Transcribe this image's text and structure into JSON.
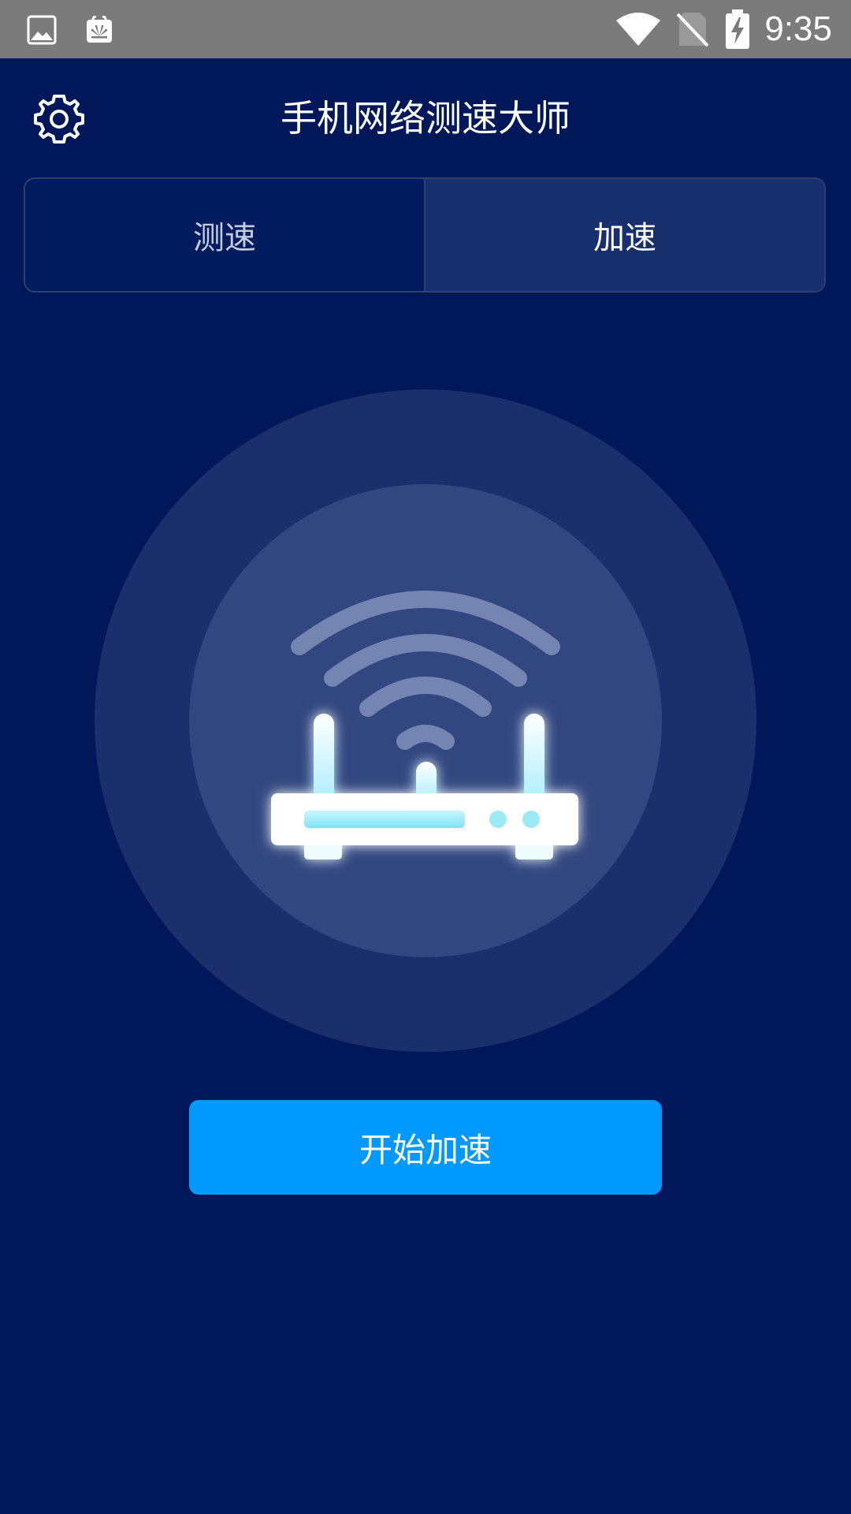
{
  "status_bar": {
    "time": "9:35",
    "icons": [
      "gallery-icon",
      "huawei-app-icon",
      "wifi-icon",
      "no-sim-icon",
      "battery-charging-icon"
    ]
  },
  "header": {
    "title": "手机网络测速大师",
    "settings_icon": "gear-icon"
  },
  "tabs": [
    {
      "label": "测速",
      "selected": false
    },
    {
      "label": "加速",
      "selected": true
    }
  ],
  "hero": {
    "icon": "wifi-router-icon"
  },
  "actions": {
    "start_label": "开始加速"
  },
  "colors": {
    "background": "#00185a",
    "button": "#0099ff",
    "status_bar": "#7b7b7b"
  }
}
